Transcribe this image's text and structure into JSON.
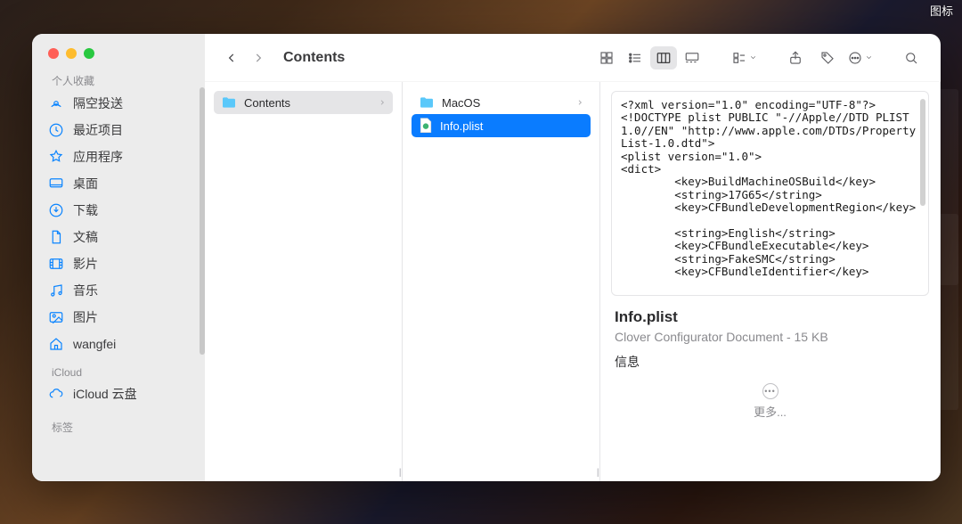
{
  "desktop": {
    "icons_label": "图标"
  },
  "window": {
    "title": "Contents"
  },
  "sidebar": {
    "sections": {
      "favorites_label": "个人收藏",
      "icloud_label": "iCloud",
      "tags_label": "标签"
    },
    "items": [
      {
        "label": "隔空投送"
      },
      {
        "label": "最近项目"
      },
      {
        "label": "应用程序"
      },
      {
        "label": "桌面"
      },
      {
        "label": "下载"
      },
      {
        "label": "文稿"
      },
      {
        "label": "影片"
      },
      {
        "label": "音乐"
      },
      {
        "label": "图片"
      },
      {
        "label": "wangfei"
      }
    ],
    "icloud_items": [
      {
        "label": "iCloud 云盘"
      }
    ]
  },
  "columns": {
    "col1": [
      {
        "name": "Contents",
        "type": "folder",
        "has_children": true,
        "selected": "gray"
      }
    ],
    "col2": [
      {
        "name": "MacOS",
        "type": "folder",
        "has_children": true
      },
      {
        "name": "Info.plist",
        "type": "file",
        "selected": "blue"
      }
    ]
  },
  "preview": {
    "content": "<?xml version=\"1.0\" encoding=\"UTF-8\"?>\n<!DOCTYPE plist PUBLIC \"-//Apple//DTD PLIST 1.0//EN\" \"http://www.apple.com/DTDs/PropertyList-1.0.dtd\">\n<plist version=\"1.0\">\n<dict>\n        <key>BuildMachineOSBuild</key>\n        <string>17G65</string>\n        <key>CFBundleDevelopmentRegion</key>\n\n        <string>English</string>\n        <key>CFBundleExecutable</key>\n        <string>FakeSMC</string>\n        <key>CFBundleIdentifier</key>",
    "filename": "Info.plist",
    "kind_size": "Clover Configurator Document - 15 KB",
    "info_label": "信息",
    "more_label": "更多..."
  }
}
